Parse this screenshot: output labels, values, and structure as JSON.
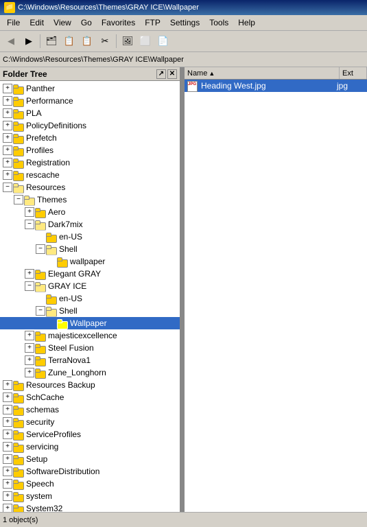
{
  "window": {
    "title": "C:\\Windows\\Resources\\Themes\\GRAY ICE\\Wallpaper",
    "icon": "📁"
  },
  "menu": {
    "items": [
      "File",
      "Edit",
      "View",
      "Go",
      "Favorites",
      "FTP",
      "Settings",
      "Tools",
      "Help"
    ]
  },
  "toolbar": {
    "buttons": [
      "◀",
      "▶",
      "🖥",
      "📋",
      "📋",
      "📋",
      "🖼",
      "⬜",
      "📄"
    ]
  },
  "address": {
    "label": "",
    "value": "C:\\Windows\\Resources\\Themes\\GRAY ICE\\Wallpaper"
  },
  "folder_tree": {
    "header": "Folder Tree",
    "items": [
      {
        "id": "panther",
        "label": "Panther",
        "indent": 1,
        "expanded": false,
        "type": "closed"
      },
      {
        "id": "performance",
        "label": "Performance",
        "indent": 1,
        "expanded": false,
        "type": "closed"
      },
      {
        "id": "pla",
        "label": "PLA",
        "indent": 1,
        "expanded": false,
        "type": "closed"
      },
      {
        "id": "policydefs",
        "label": "PolicyDefinitions",
        "indent": 1,
        "expanded": false,
        "type": "closed"
      },
      {
        "id": "prefetch",
        "label": "Prefetch",
        "indent": 1,
        "expanded": false,
        "type": "closed"
      },
      {
        "id": "profiles",
        "label": "Profiles",
        "indent": 1,
        "expanded": false,
        "type": "closed"
      },
      {
        "id": "registration",
        "label": "Registration",
        "indent": 1,
        "expanded": false,
        "type": "closed"
      },
      {
        "id": "rescache",
        "label": "rescache",
        "indent": 1,
        "expanded": false,
        "type": "closed"
      },
      {
        "id": "resources",
        "label": "Resources",
        "indent": 1,
        "expanded": true,
        "type": "open"
      },
      {
        "id": "themes",
        "label": "Themes",
        "indent": 2,
        "expanded": true,
        "type": "open"
      },
      {
        "id": "aero",
        "label": "Aero",
        "indent": 3,
        "expanded": false,
        "type": "closed"
      },
      {
        "id": "dark7mix",
        "label": "Dark7mix",
        "indent": 3,
        "expanded": true,
        "type": "open"
      },
      {
        "id": "dark7mix_enus",
        "label": "en-US",
        "indent": 4,
        "expanded": false,
        "type": "closed",
        "noexpander": true
      },
      {
        "id": "dark7mix_shell",
        "label": "Shell",
        "indent": 4,
        "expanded": true,
        "type": "open"
      },
      {
        "id": "dark7mix_wallpaper",
        "label": "wallpaper",
        "indent": 5,
        "expanded": false,
        "type": "closed",
        "noexpander": true
      },
      {
        "id": "elegant_gray",
        "label": "Elegant GRAY",
        "indent": 3,
        "expanded": false,
        "type": "closed"
      },
      {
        "id": "gray_ice",
        "label": "GRAY ICE",
        "indent": 3,
        "expanded": true,
        "type": "open"
      },
      {
        "id": "gray_ice_enus",
        "label": "en-US",
        "indent": 4,
        "expanded": false,
        "type": "closed",
        "noexpander": true
      },
      {
        "id": "gray_ice_shell",
        "label": "Shell",
        "indent": 4,
        "expanded": true,
        "type": "open"
      },
      {
        "id": "gray_ice_wallpaper",
        "label": "Wallpaper",
        "indent": 5,
        "expanded": false,
        "type": "closed",
        "noexpander": true,
        "selected": true
      },
      {
        "id": "majesticexcellence",
        "label": "majesticexcellence",
        "indent": 3,
        "expanded": false,
        "type": "closed"
      },
      {
        "id": "steel_fusion",
        "label": "Steel Fusion",
        "indent": 3,
        "expanded": false,
        "type": "closed"
      },
      {
        "id": "terranova1",
        "label": "TerraNova1",
        "indent": 3,
        "expanded": false,
        "type": "closed"
      },
      {
        "id": "zune_longhorn",
        "label": "Zune_Longhorn",
        "indent": 3,
        "expanded": false,
        "type": "closed"
      },
      {
        "id": "resources_backup",
        "label": "Resources Backup",
        "indent": 1,
        "expanded": false,
        "type": "closed"
      },
      {
        "id": "schcache",
        "label": "SchCache",
        "indent": 1,
        "expanded": false,
        "type": "closed"
      },
      {
        "id": "schemas",
        "label": "schemas",
        "indent": 1,
        "expanded": false,
        "type": "closed"
      },
      {
        "id": "security",
        "label": "security",
        "indent": 1,
        "expanded": false,
        "type": "closed"
      },
      {
        "id": "serviceprofiles",
        "label": "ServiceProfiles",
        "indent": 1,
        "expanded": false,
        "type": "closed"
      },
      {
        "id": "servicing",
        "label": "servicing",
        "indent": 1,
        "expanded": false,
        "type": "closed"
      },
      {
        "id": "setup",
        "label": "Setup",
        "indent": 1,
        "expanded": false,
        "type": "closed"
      },
      {
        "id": "softwaredistribution",
        "label": "SoftwareDistribution",
        "indent": 1,
        "expanded": false,
        "type": "closed"
      },
      {
        "id": "speech",
        "label": "Speech",
        "indent": 1,
        "expanded": false,
        "type": "closed"
      },
      {
        "id": "system",
        "label": "system",
        "indent": 1,
        "expanded": false,
        "type": "closed"
      },
      {
        "id": "system32",
        "label": "System32",
        "indent": 1,
        "expanded": false,
        "type": "closed"
      }
    ]
  },
  "file_list": {
    "columns": [
      {
        "id": "name",
        "label": "Name",
        "sort": "asc"
      },
      {
        "id": "ext",
        "label": "Ext"
      }
    ],
    "files": [
      {
        "name": "Heading West.jpg",
        "ext": "jpg",
        "icon": "jpg",
        "selected": true
      }
    ]
  },
  "colors": {
    "selected_bg": "#316ac5",
    "selected_text": "#ffffff",
    "title_grad_start": "#0a246a",
    "title_grad_end": "#3a6ea5"
  }
}
